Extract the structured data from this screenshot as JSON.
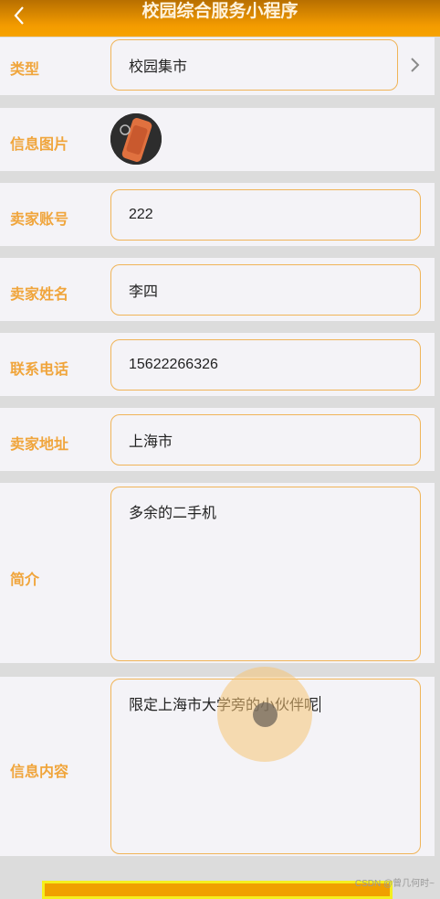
{
  "header": {
    "title": "校园综合服务小程序"
  },
  "form": {
    "type": {
      "label": "类型",
      "value": "校园集市"
    },
    "image": {
      "label": "信息图片"
    },
    "seller_account": {
      "label": "卖家账号",
      "value": "222"
    },
    "seller_name": {
      "label": "卖家姓名",
      "value": "李四"
    },
    "phone": {
      "label": "联系电话",
      "value": "15622266326"
    },
    "address": {
      "label": "卖家地址",
      "value": "上海市"
    },
    "intro": {
      "label": "简介",
      "value": "多余的二手机"
    },
    "content": {
      "label": "信息内容",
      "value": "限定上海市大学旁的小伙伴呢"
    }
  },
  "watermark": "CSDN @曾几何时~",
  "colors": {
    "accent": "#f0a53c",
    "header": "#f39b00",
    "border": "#f0b458"
  },
  "icons": {
    "back": "chevron-left-icon",
    "select": "chevron-right-icon"
  }
}
